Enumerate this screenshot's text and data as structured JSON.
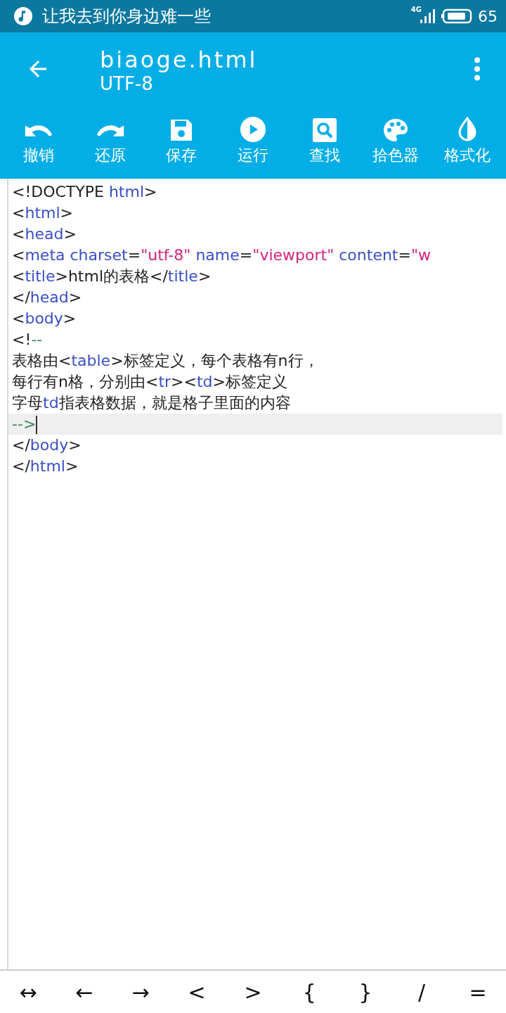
{
  "status_bar": {
    "notification": "让我去到你身边难一些",
    "network": "4G",
    "battery": "65"
  },
  "app_bar": {
    "title": "biaoge.html",
    "subtitle": "UTF-8"
  },
  "toolbar": [
    {
      "kind": "undo",
      "label": "撤销"
    },
    {
      "kind": "redo",
      "label": "还原"
    },
    {
      "kind": "save",
      "label": "保存"
    },
    {
      "kind": "run",
      "label": "运行"
    },
    {
      "kind": "find",
      "label": "查找"
    },
    {
      "kind": "palette",
      "label": "拾色器"
    },
    {
      "kind": "format",
      "label": "格式化"
    }
  ],
  "editor": {
    "lines": [
      {
        "current": false,
        "tokens": [
          {
            "kind": "text",
            "text": "<!DOCTYPE "
          },
          {
            "kind": "tag",
            "text": "html"
          },
          {
            "kind": "text",
            "text": ">"
          }
        ]
      },
      {
        "current": false,
        "tokens": [
          {
            "kind": "text",
            "text": "<"
          },
          {
            "kind": "tag",
            "text": "html"
          },
          {
            "kind": "text",
            "text": ">"
          }
        ]
      },
      {
        "current": false,
        "tokens": [
          {
            "kind": "text",
            "text": "<"
          },
          {
            "kind": "tag",
            "text": "head"
          },
          {
            "kind": "text",
            "text": ">"
          }
        ]
      },
      {
        "current": false,
        "tokens": [
          {
            "kind": "text",
            "text": "<"
          },
          {
            "kind": "tag",
            "text": "meta charset"
          },
          {
            "kind": "text",
            "text": "="
          },
          {
            "kind": "string",
            "text": "\"utf-8\""
          },
          {
            "kind": "tag",
            "text": " name"
          },
          {
            "kind": "text",
            "text": "="
          },
          {
            "kind": "string",
            "text": "\"viewport\""
          },
          {
            "kind": "tag",
            "text": " content"
          },
          {
            "kind": "text",
            "text": "="
          },
          {
            "kind": "string",
            "text": "\"w"
          }
        ]
      },
      {
        "current": false,
        "tokens": [
          {
            "kind": "text",
            "text": "<"
          },
          {
            "kind": "tag",
            "text": "title"
          },
          {
            "kind": "text",
            "text": ">html的表格</"
          },
          {
            "kind": "tag",
            "text": "title"
          },
          {
            "kind": "text",
            "text": ">"
          }
        ]
      },
      {
        "current": false,
        "tokens": [
          {
            "kind": "text",
            "text": "</"
          },
          {
            "kind": "tag",
            "text": "head"
          },
          {
            "kind": "text",
            "text": ">"
          }
        ]
      },
      {
        "current": false,
        "tokens": [
          {
            "kind": "text",
            "text": "<"
          },
          {
            "kind": "tag",
            "text": "body"
          },
          {
            "kind": "text",
            "text": ">"
          }
        ]
      },
      {
        "current": false,
        "tokens": [
          {
            "kind": "text",
            "text": "<!"
          },
          {
            "kind": "comment",
            "text": "--"
          }
        ]
      },
      {
        "current": false,
        "tokens": [
          {
            "kind": "text",
            "text": "表格由<"
          },
          {
            "kind": "tag",
            "text": "table"
          },
          {
            "kind": "text",
            "text": ">标签定义，每个表格有n行，"
          }
        ]
      },
      {
        "current": false,
        "tokens": [
          {
            "kind": "text",
            "text": "每行有n格，分别由<"
          },
          {
            "kind": "tag",
            "text": "tr"
          },
          {
            "kind": "text",
            "text": "><"
          },
          {
            "kind": "tag",
            "text": "td"
          },
          {
            "kind": "text",
            "text": ">标签定义"
          }
        ]
      },
      {
        "current": false,
        "tokens": [
          {
            "kind": "text",
            "text": "字母"
          },
          {
            "kind": "tag",
            "text": "td"
          },
          {
            "kind": "text",
            "text": "指表格数据，就是格子里面的内容"
          }
        ]
      },
      {
        "current": true,
        "tokens": [
          {
            "kind": "comment",
            "text": "-->"
          }
        ]
      },
      {
        "current": false,
        "tokens": [
          {
            "kind": "text",
            "text": "</"
          },
          {
            "kind": "tag",
            "text": "body"
          },
          {
            "kind": "text",
            "text": ">"
          }
        ]
      },
      {
        "current": false,
        "tokens": [
          {
            "kind": "text",
            "text": "</"
          },
          {
            "kind": "tag",
            "text": "html"
          },
          {
            "kind": "text",
            "text": ">"
          }
        ]
      }
    ]
  },
  "symbol_keys": [
    "↔",
    "←",
    "→",
    "<",
    ">",
    "{",
    "}",
    "/",
    "="
  ]
}
